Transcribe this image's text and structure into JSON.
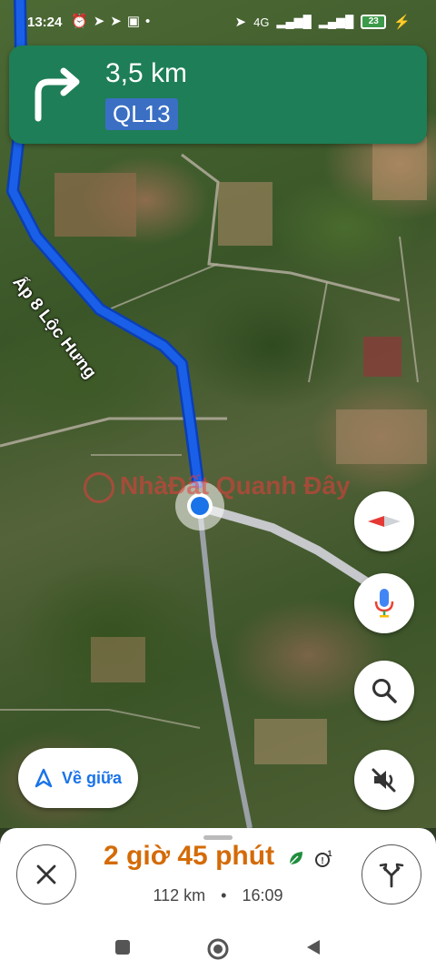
{
  "status_bar": {
    "time": "13:24",
    "network": "4G",
    "battery": "23"
  },
  "navigation": {
    "distance": "3,5 km",
    "road": "QL13"
  },
  "map": {
    "road_label": "Ấp 8 Lộc Hưng",
    "watermark": "NhàĐất Quanh Đây"
  },
  "controls": {
    "recenter_label": "Về giữa"
  },
  "trip": {
    "eta_hours": "2",
    "eta_hours_unit": "giờ",
    "eta_minutes": "45",
    "eta_minutes_unit": "phút",
    "distance": "112 km",
    "separator": "•",
    "arrival_time": "16:09"
  },
  "colors": {
    "nav_green": "#1e7e57",
    "route_blue": "#1a5fe8",
    "eta_orange": "#d46b08",
    "badge_blue": "#3a6fc4"
  }
}
